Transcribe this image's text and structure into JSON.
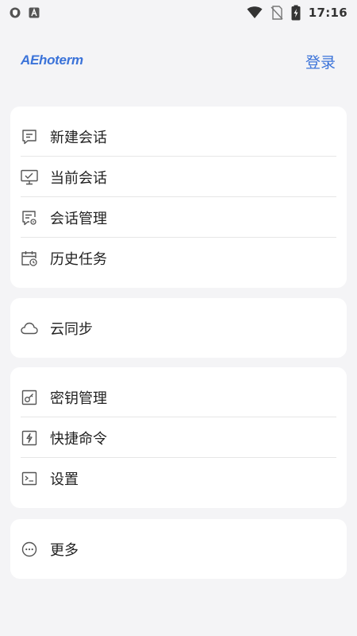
{
  "status_bar": {
    "time": "17:16",
    "icons": [
      "shield-icon",
      "a-icon",
      "wifi-icon",
      "no-sim-icon",
      "battery-charging-icon"
    ]
  },
  "app": {
    "logo_text": "AEhoterm",
    "login_label": "登录",
    "accent_color": "#3b73d9"
  },
  "menu": {
    "group1": [
      {
        "label": "新建会话",
        "icon": "new-session-icon"
      },
      {
        "label": "当前会话",
        "icon": "current-session-icon"
      },
      {
        "label": "会话管理",
        "icon": "session-management-icon"
      },
      {
        "label": "历史任务",
        "icon": "calendar-history-icon"
      }
    ],
    "group2": [
      {
        "label": "云同步",
        "icon": "cloud-icon"
      }
    ],
    "group3": [
      {
        "label": "密钥管理",
        "icon": "key-icon"
      },
      {
        "label": "快捷命令",
        "icon": "lightning-icon"
      },
      {
        "label": "设置",
        "icon": "terminal-icon"
      }
    ],
    "group4": [
      {
        "label": "更多",
        "icon": "more-icon"
      }
    ]
  }
}
